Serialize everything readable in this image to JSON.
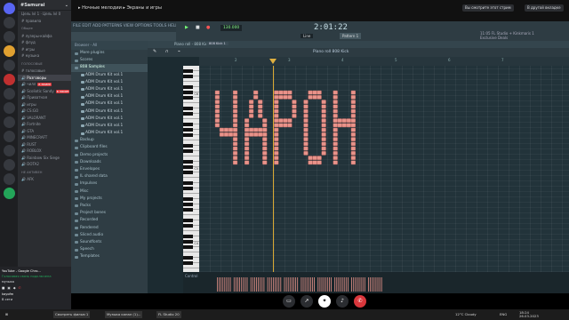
{
  "discord": {
    "server_name": "#Samurai",
    "server_sub": "Цель lvl 1",
    "server_right": "Цель lvl 0",
    "channels": [
      {
        "label": "правила",
        "type": "text"
      },
      {
        "label": "Общее",
        "type": "cat"
      },
      {
        "label": "лузеры-кайфа",
        "type": "text"
      },
      {
        "label": "флуд",
        "type": "text"
      },
      {
        "label": "игры",
        "type": "text"
      },
      {
        "label": "музыка",
        "type": "text"
      },
      {
        "label": "ГОЛОСОВЫЕ",
        "type": "cat"
      },
      {
        "label": "голосовые",
        "type": "text"
      },
      {
        "label": "Разговоры",
        "type": "voice"
      },
      {
        "label": "чилл",
        "type": "voice",
        "live": "В ЭФИРЕ"
      },
      {
        "label": "Scoliotic Sandy",
        "type": "voice",
        "live": "В ЭФИРЕ"
      },
      {
        "label": "Приватная",
        "type": "voice"
      },
      {
        "label": "игры",
        "type": "voice"
      },
      {
        "label": "CS:GO",
        "type": "voice"
      },
      {
        "label": "VALORANT",
        "type": "voice"
      },
      {
        "label": "Fortnite",
        "type": "voice"
      },
      {
        "label": "GTA",
        "type": "voice"
      },
      {
        "label": "MINECRAFT",
        "type": "voice"
      },
      {
        "label": "RUST",
        "type": "voice"
      },
      {
        "label": "ROBLOX",
        "type": "voice"
      },
      {
        "label": "Rainbow Six Siege",
        "type": "voice"
      },
      {
        "label": "DOTA2",
        "type": "voice"
      },
      {
        "label": "НЕ АКТИВЕН",
        "type": "cat"
      },
      {
        "label": "AFK",
        "type": "voice"
      }
    ],
    "activity": "YouTube - Google Chro...",
    "voice_status": "Голосовая связь подключена",
    "voice_channel": "музыка",
    "username": "kayofm",
    "user_status": "В сети"
  },
  "stream": {
    "title": "Ночные мелодии",
    "tab2": "Экраны и игры",
    "button_right": "Вы смотрите этот стрим",
    "button_more": "В другой вкладке"
  },
  "fl": {
    "menu": "FILE EDIT ADD PATTERNS VIEW OPTIONS TOOLS HELP",
    "tempo": "130.000",
    "time": "2:01:22",
    "pattern": "Pattern 1",
    "hint_1": "11:05  FL Studio + Kinkmaris 1",
    "hint_2": "Exclusive Deals",
    "line_label": "Line",
    "browser_title": "Browser - All",
    "browser": [
      {
        "label": "More plugins",
        "sub": false
      },
      {
        "label": "Scores",
        "sub": false
      },
      {
        "label": "808 Samples",
        "sub": false,
        "hl": true
      },
      {
        "label": "ADM Drum Kit vol.1",
        "sub": true
      },
      {
        "label": "ADM Drum Kit vol.1",
        "sub": true
      },
      {
        "label": "ADM Drum Kit vol.1",
        "sub": true
      },
      {
        "label": "ADM Drum Kit vol.1",
        "sub": true
      },
      {
        "label": "ADM Drum Kit vol.1",
        "sub": true
      },
      {
        "label": "ADM Drum Kit vol.1",
        "sub": true
      },
      {
        "label": "ADM Drum Kit vol.1",
        "sub": true
      },
      {
        "label": "ADM Drum Kit vol.1",
        "sub": true
      },
      {
        "label": "ADM Drum Kit vol.1",
        "sub": true
      },
      {
        "label": "Backup",
        "sub": false
      },
      {
        "label": "Clipboard files",
        "sub": false
      },
      {
        "label": "Demo projects",
        "sub": false
      },
      {
        "label": "Downloads",
        "sub": false
      },
      {
        "label": "Envelopes",
        "sub": false
      },
      {
        "label": "IL shared data",
        "sub": false
      },
      {
        "label": "Impulses",
        "sub": false
      },
      {
        "label": "Misc",
        "sub": false
      },
      {
        "label": "My projects",
        "sub": false
      },
      {
        "label": "Packs",
        "sub": false
      },
      {
        "label": "Project bones",
        "sub": false
      },
      {
        "label": "Recorded",
        "sub": false
      },
      {
        "label": "Rendered",
        "sub": false
      },
      {
        "label": "Sliced audio",
        "sub": false
      },
      {
        "label": "Soundfonts",
        "sub": false
      },
      {
        "label": "Speech",
        "sub": false
      },
      {
        "label": "Templates",
        "sub": false
      }
    ],
    "pr_title": "Piano roll - 808 Kick",
    "breadcrumb": "Piano roll  808 Kick",
    "channel_badge": "808 Kick 1",
    "ruler": [
      "2",
      "3",
      "4",
      "5",
      "6",
      "7"
    ],
    "note_labels": [
      "C6",
      "C5",
      "C4"
    ],
    "control_label": "Control",
    "notes_word": "ЧАРОН",
    "note_color": "#e8938a"
  },
  "taskbar": {
    "items": [
      "Смотреть фильм 1",
      "Музыка канал (1)...",
      "FL Studio 20"
    ],
    "weather": "12°C Cloudy",
    "time": "18:24",
    "date": "26.03.2023",
    "lang": "ENG"
  }
}
